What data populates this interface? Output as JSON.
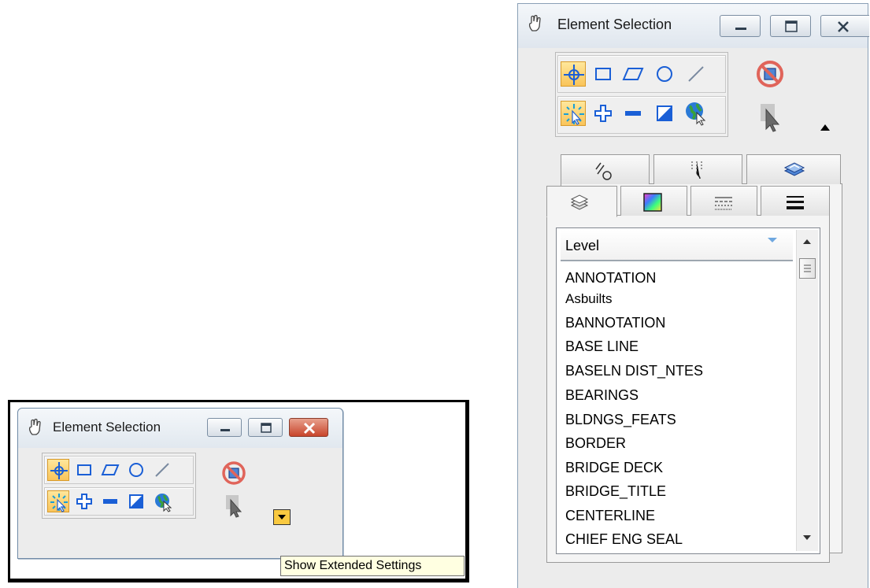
{
  "small_window": {
    "title": "Element Selection",
    "icon": "hand-pointer-icon",
    "tooltip": "Show Extended Settings"
  },
  "large_window": {
    "title": "Element Selection",
    "icon": "hand-pointer-icon",
    "tabs_row1": [
      {
        "icon": "line-style-icon"
      },
      {
        "icon": "weight-connector-icon"
      },
      {
        "icon": "view-layer-icon"
      }
    ],
    "tabs_row2": [
      {
        "icon": "levels-icon",
        "active": true
      },
      {
        "icon": "color-icon"
      },
      {
        "icon": "line-style-pattern-icon"
      },
      {
        "icon": "line-weight-icon"
      }
    ],
    "list": {
      "header": "Level",
      "items": [
        "ANNOTATION",
        "Asbuilts",
        "BANNOTATION",
        "BASE LINE",
        "BASELN DIST_NTES",
        "BEARINGS",
        "BLDNGS_FEATS",
        "BORDER",
        "BRIDGE DECK",
        "BRIDGE_TITLE",
        "CENTERLINE",
        "CHIEF ENG SEAL"
      ]
    }
  },
  "colors": {
    "active_tool": "#f9c45a",
    "tooltip_bg": "#ffffe1",
    "close_button": "#c8452b",
    "tool_blue": "#1a5fd6"
  }
}
